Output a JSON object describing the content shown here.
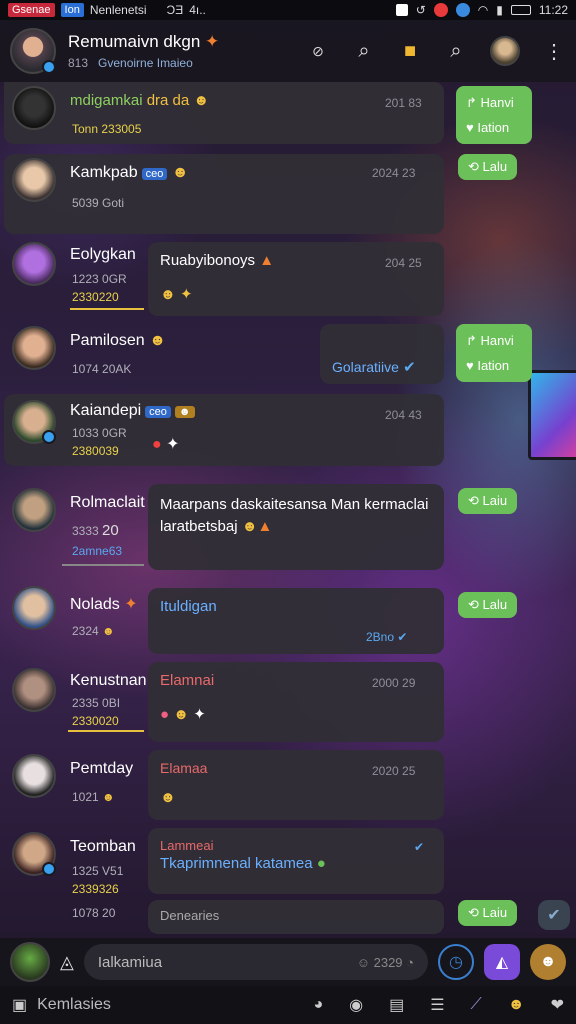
{
  "status_bar": {
    "chip1": "Gsenae",
    "chip2": "Ion",
    "app": "Nenlenetsi",
    "mid1": "ƆƎ",
    "mid2": "4ı..",
    "time": "11:22"
  },
  "header": {
    "title": "Remumaivn dkgn",
    "count": "813",
    "subtitle": "Gvenoirne Imaieo"
  },
  "messages": [
    {
      "name": "mdigamkai",
      "extra": "dra da",
      "time": "201 83",
      "meta": "Tonn 233005",
      "reply": [
        "Hanvi",
        "Iation"
      ]
    },
    {
      "name": "Kamkpab",
      "tag": "ceo",
      "time": "2024 23",
      "meta": "5039 Goti",
      "reply": [
        "Lalu"
      ]
    },
    {
      "name": "Eolygkan",
      "meta1": "1223 0GR",
      "meta2": "2330220",
      "text": "Ruabyibonoys",
      "time": "204 25"
    },
    {
      "name": "Pamilosen",
      "meta": "1074 20AK",
      "text": "Golaratiive",
      "reply": [
        "Hanvi",
        "Iation"
      ]
    },
    {
      "name": "Kaiandepi",
      "tag": "ceo",
      "meta1": "1033 0GR",
      "meta2": "2380039",
      "time": "204 43"
    },
    {
      "name": "Rolmaclait",
      "meta1": "3333",
      "meta1b": "20",
      "meta2": "2amne63",
      "text": "Maarpans daskaitesansa Man kermaclai laratbetsbaj",
      "reply": [
        "Laiu"
      ]
    },
    {
      "name": "Nolads",
      "meta": "2324",
      "text": "Ituldigan",
      "time": "2Bno",
      "reply": [
        "Lalu"
      ]
    },
    {
      "name": "Kenustnan",
      "meta1": "2335 0BI",
      "meta2": "2330020",
      "text": "Elamnai",
      "time": "2000 29"
    },
    {
      "name": "Pemtday",
      "meta": "1021",
      "text": "Elamaa",
      "time": "2020 25"
    },
    {
      "name": "Teomban",
      "meta1": "1325 V51",
      "meta2": "2339326",
      "meta3": "1078 20",
      "text1": "Lammeai",
      "text2": "Tkaprimnenal katamea",
      "foot": "Denearies",
      "reply": [
        "Laiu"
      ]
    }
  ],
  "composer": {
    "placeholder": "Ialkamiua",
    "counter": "2329"
  },
  "bottom_bar": {
    "label": "Kemlasies"
  },
  "colors": {
    "accent_green": "#6cc05a",
    "accent_purple": "#7a4ad8",
    "link_blue": "#5aa8f0",
    "meta_yellow": "#e8d24a"
  }
}
